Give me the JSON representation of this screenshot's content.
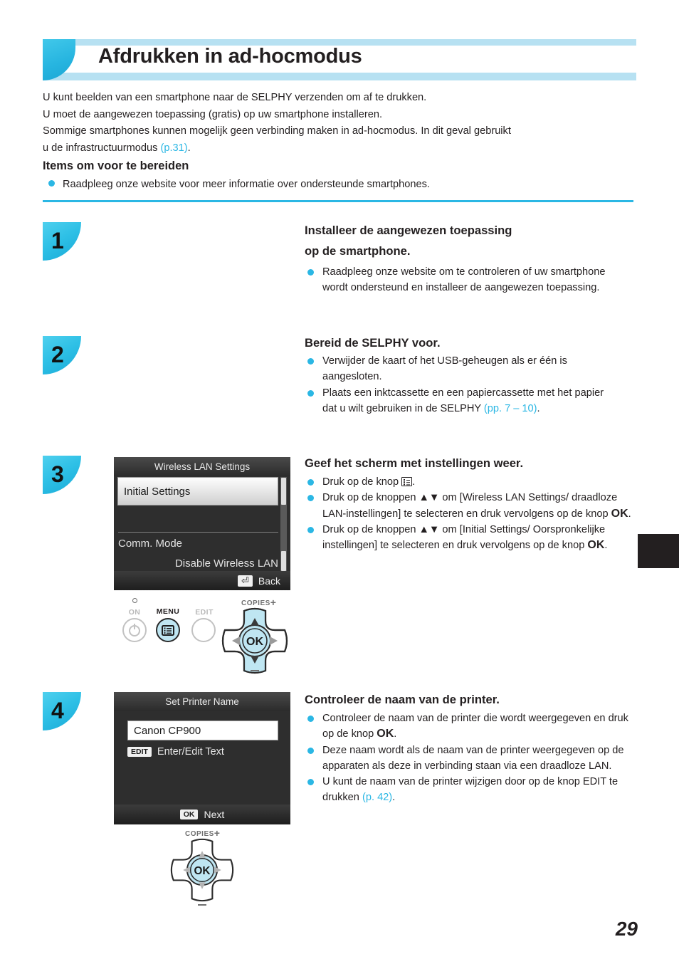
{
  "header": {
    "title": "Afdrukken in ad-hocmodus",
    "accent_color": "#2bb7e4",
    "band_color": "#b7e1f2"
  },
  "intro": {
    "line1": "U kunt beelden van een smartphone naar de SELPHY verzenden om af te drukken.",
    "line2": "U moet de aangewezen toepassing (gratis) op uw smartphone installeren.",
    "line3": "Sommige smartphones kunnen mogelijk geen verbinding maken in ad-hocmodus. In dit geval gebruikt",
    "line4_pre": "u de infrastructuurmodus ",
    "line4_ref": "(p.31)",
    "line4_post": "."
  },
  "prepare": {
    "heading": "Items om voor te bereiden",
    "bullet": "Raadpleeg onze website voor meer informatie over ondersteunde smartphones."
  },
  "steps": [
    {
      "number": "1",
      "title_line1": "Installeer de aangewezen toepassing",
      "title_line2": "op de smartphone.",
      "bullets": [
        {
          "text": "Raadpleeg onze website om te controleren of uw smartphone wordt ondersteund en installeer de aangewezen toepassing."
        }
      ]
    },
    {
      "number": "2",
      "title_line1": "Bereid de SELPHY voor.",
      "title_line2": "",
      "bullets": [
        {
          "text": "Verwijder de kaart of het USB-geheugen als er één is aangesloten."
        },
        {
          "text_pre": "Plaats een inktcassette en een papiercassette met het papier dat u wilt gebruiken in de SELPHY ",
          "ref": "(pp. 7 – 10)",
          "text_post": "."
        }
      ]
    },
    {
      "number": "3",
      "title_line1": "Geef het scherm met instellingen weer.",
      "title_line2": "",
      "bullets": [
        {
          "pre": "Druk op de knop ",
          "glyph": "menu-icon",
          "post": "."
        },
        {
          "pre": "Druk op de knoppen ▲▼ om [Wireless LAN Settings/ draadloze LAN-instellingen] te selecteren en druk vervolgens op de knop ",
          "ok": "OK",
          "post": "."
        },
        {
          "pre": "Druk op de knoppen ▲▼ om [Initial Settings/ Oorspronkelijke instellingen] te selecteren en druk vervolgens op de knop ",
          "ok": "OK",
          "post": "."
        }
      ]
    },
    {
      "number": "4",
      "title_line1": "Controleer de naam van de printer.",
      "title_line2": "",
      "bullets": [
        {
          "pre": "Controleer de naam van de printer die wordt weergegeven en druk op de knop ",
          "ok": "OK",
          "post": "."
        },
        {
          "text": "Deze naam wordt als de naam van de printer weergegeven op de apparaten als deze in verbinding staan via een draadloze LAN."
        },
        {
          "pre": "U kunt de naam van de printer wijzigen door op de knop EDIT te drukken ",
          "ref": "(p. 42)",
          "post": "."
        }
      ]
    }
  ],
  "lcd_wireless": {
    "title": "Wireless LAN Settings",
    "selected_item": "Initial Settings",
    "item2_label": "Comm. Mode",
    "item2_value": "Disable Wireless LAN",
    "footer_key": "⏎",
    "footer_label": "Back"
  },
  "lcd_printer_name": {
    "title": "Set Printer Name",
    "printer_name": "Canon CP900",
    "edit_key": "EDIT",
    "edit_label": "Enter/Edit Text",
    "footer_key": "OK",
    "footer_label": "Next"
  },
  "button_panel": {
    "lamp_label": "ON",
    "menu_label": "MENU",
    "edit_label": "EDIT",
    "copies_label": "COPIES",
    "ok_label": "OK",
    "plus_sign": "+"
  },
  "button_panel_small": {
    "copies_label": "COPIES",
    "ok_label": "OK",
    "plus_sign": "+"
  },
  "footer": {
    "page_number": "29"
  }
}
